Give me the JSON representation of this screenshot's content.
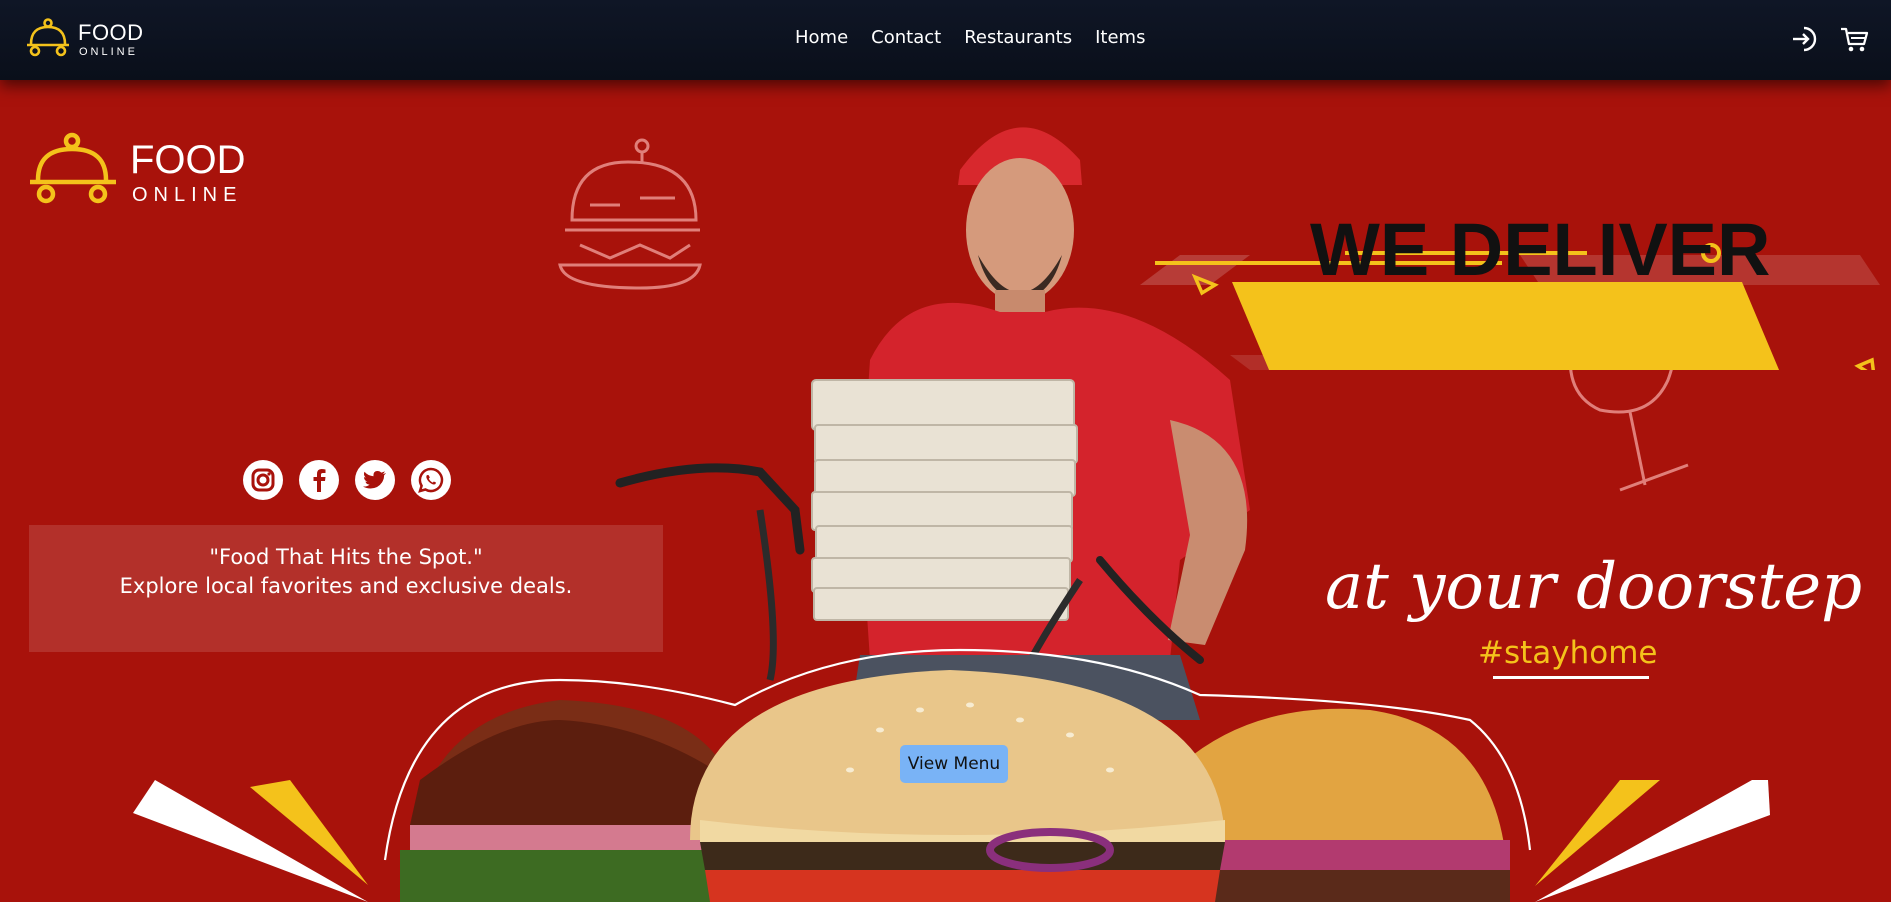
{
  "navbar": {
    "brand": "FOOD",
    "brand_sub": "ONLINE",
    "links": [
      "Home",
      "Contact",
      "Restaurants",
      "Items"
    ],
    "icons": [
      "login-icon",
      "cart-icon"
    ]
  },
  "hero": {
    "brand": "FOOD",
    "brand_sub": "ONLINE",
    "social": [
      "instagram-icon",
      "facebook-icon",
      "twitter-icon",
      "whatsapp-icon"
    ],
    "tagline_quote": "\"Food That Hits the Spot.\"",
    "tagline_sub": "Explore local favorites and exclusive deals.",
    "banner_text": "WE DELIVER",
    "slogan": "at your doorstep",
    "hashtag": "#stayhome",
    "cta_label": "View Menu"
  },
  "colors": {
    "hero_bg": "#a8120b",
    "nav_bg": "#0f1626",
    "accent_yellow": "#f4c21b",
    "cta_blue": "#79b3f6"
  }
}
